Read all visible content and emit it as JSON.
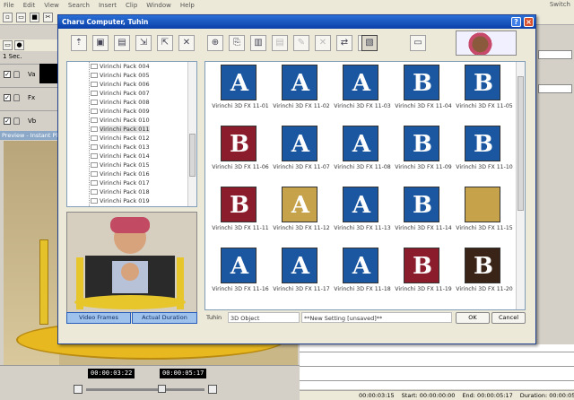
{
  "app": {
    "menu": [
      "File",
      "Edit",
      "View",
      "Search",
      "Insert",
      "Clip",
      "Window",
      "Help"
    ],
    "menu_right": "Switch",
    "time_scale": "1 Sec.",
    "tracks": [
      "Va",
      "Fx",
      "Vb"
    ],
    "preview_title": "Preview - Instant Play",
    "timecode_left": "00:00:03:22",
    "timecode_right": "00:00:05:17",
    "status": {
      "position": "00:00:03:15",
      "start": "Start: 00:00:00:00",
      "end": "End: 00:00:05:17",
      "duration": "Duration: 00:00:05:17"
    }
  },
  "dialog": {
    "title": "Charu Computer, Tuhin",
    "tree_items": [
      "Virinchi Pack 004",
      "Virinchi Pack 005",
      "Virinchi Pack 006",
      "Virinchi Pack 007",
      "Virinchi Pack 008",
      "Virinchi Pack 009",
      "Virinchi Pack 010",
      "Virinchi Pack 011",
      "Virinchi Pack 012",
      "Virinchi Pack 013",
      "Virinchi Pack 014",
      "Virinchi Pack 015",
      "Virinchi Pack 016",
      "Virinchi Pack 017",
      "Virinchi Pack 018",
      "Virinchi Pack 019"
    ],
    "selected_tree_item": "Virinchi Pack 011",
    "mode_buttons": [
      "Video Frames",
      "Actual Duration"
    ],
    "effects": [
      {
        "name": "Virinchi 3D FX 11-01",
        "glyph": "A",
        "style": "blue"
      },
      {
        "name": "Virinchi 3D FX 11-02",
        "glyph": "A",
        "style": "blue"
      },
      {
        "name": "Virinchi 3D FX 11-03",
        "glyph": "A",
        "style": "blue"
      },
      {
        "name": "Virinchi 3D FX 11-04",
        "glyph": "B",
        "style": "blue"
      },
      {
        "name": "Virinchi 3D FX 11-05",
        "glyph": "B",
        "style": "blue"
      },
      {
        "name": "Virinchi 3D FX 11-06",
        "glyph": "B",
        "style": "maroon"
      },
      {
        "name": "Virinchi 3D FX 11-07",
        "glyph": "A",
        "style": "blue"
      },
      {
        "name": "Virinchi 3D FX 11-08",
        "glyph": "A",
        "style": "blue"
      },
      {
        "name": "Virinchi 3D FX 11-09",
        "glyph": "B",
        "style": "blue"
      },
      {
        "name": "Virinchi 3D FX 11-10",
        "glyph": "B",
        "style": "blue"
      },
      {
        "name": "Virinchi 3D FX 11-11",
        "glyph": "B",
        "style": "maroon"
      },
      {
        "name": "Virinchi 3D FX 11-12",
        "glyph": "A",
        "style": "gold"
      },
      {
        "name": "Virinchi 3D FX 11-13",
        "glyph": "A",
        "style": "blue"
      },
      {
        "name": "Virinchi 3D FX 11-14",
        "glyph": "B",
        "style": "blue"
      },
      {
        "name": "Virinchi 3D FX 11-15",
        "glyph": "",
        "style": "gold"
      },
      {
        "name": "Virinchi 3D FX 11-16",
        "glyph": "A",
        "style": "blue"
      },
      {
        "name": "Virinchi 3D FX 11-17",
        "glyph": "A",
        "style": "blue"
      },
      {
        "name": "Virinchi 3D FX 11-18",
        "glyph": "A",
        "style": "blue"
      },
      {
        "name": "Virinchi 3D FX 11-19",
        "glyph": "B",
        "style": "maroon"
      },
      {
        "name": "Virinchi 3D FX 11-20",
        "glyph": "B",
        "style": "dark"
      }
    ],
    "footer": {
      "user": "Tuhin",
      "type": "3D Object",
      "setting": "**New Setting [unsaved]**",
      "ok": "OK",
      "cancel": "Cancel"
    }
  }
}
